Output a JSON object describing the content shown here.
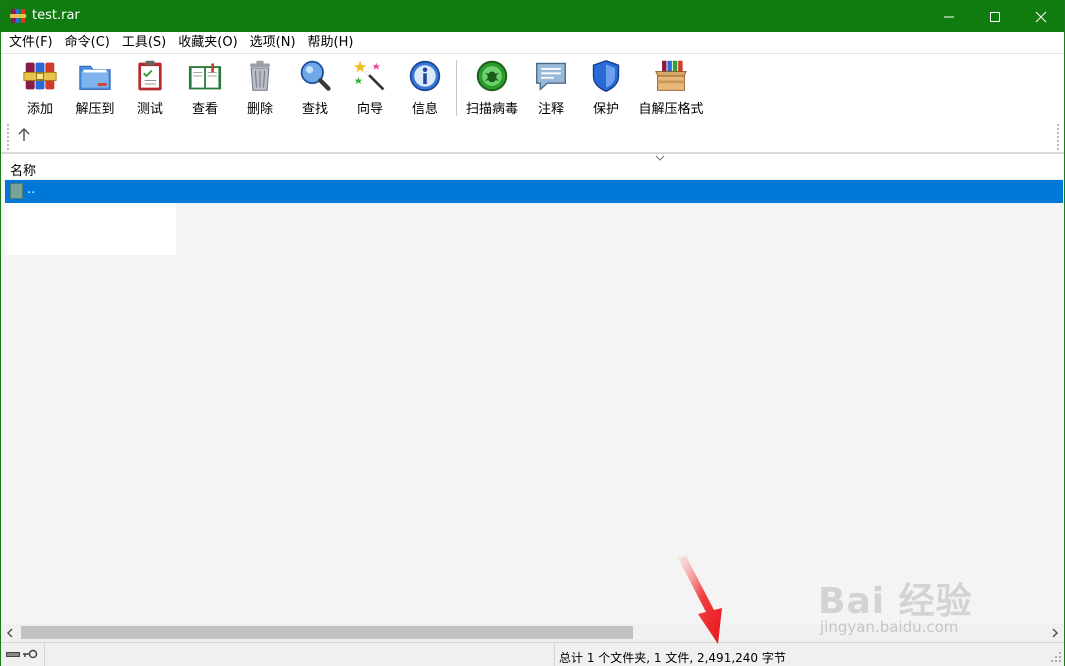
{
  "window": {
    "title": "test.rar"
  },
  "menu": {
    "items": [
      {
        "label": "文件(F)"
      },
      {
        "label": "命令(C)"
      },
      {
        "label": "工具(S)"
      },
      {
        "label": "收藏夹(O)"
      },
      {
        "label": "选项(N)"
      },
      {
        "label": "帮助(H)"
      }
    ]
  },
  "toolbar": {
    "add": "添加",
    "extract": "解压到",
    "test": "测试",
    "view": "查看",
    "delete": "删除",
    "find": "查找",
    "wizard": "向导",
    "info": "信息",
    "scan": "扫描病毒",
    "comment": "注释",
    "protect": "保护",
    "sfx": "自解压格式"
  },
  "filelist": {
    "column_name": "名称",
    "rows": [
      {
        "name": ".."
      }
    ]
  },
  "status": {
    "summary": "总计 1 个文件夹, 1 文件, 2,491,240 字节"
  },
  "watermark": {
    "brand": "Bai 经验",
    "url": "jingyan.baidu.com"
  },
  "colors": {
    "titlebar": "#107c10",
    "selection": "#0078d7",
    "annotation_arrow": "#e8131e"
  }
}
